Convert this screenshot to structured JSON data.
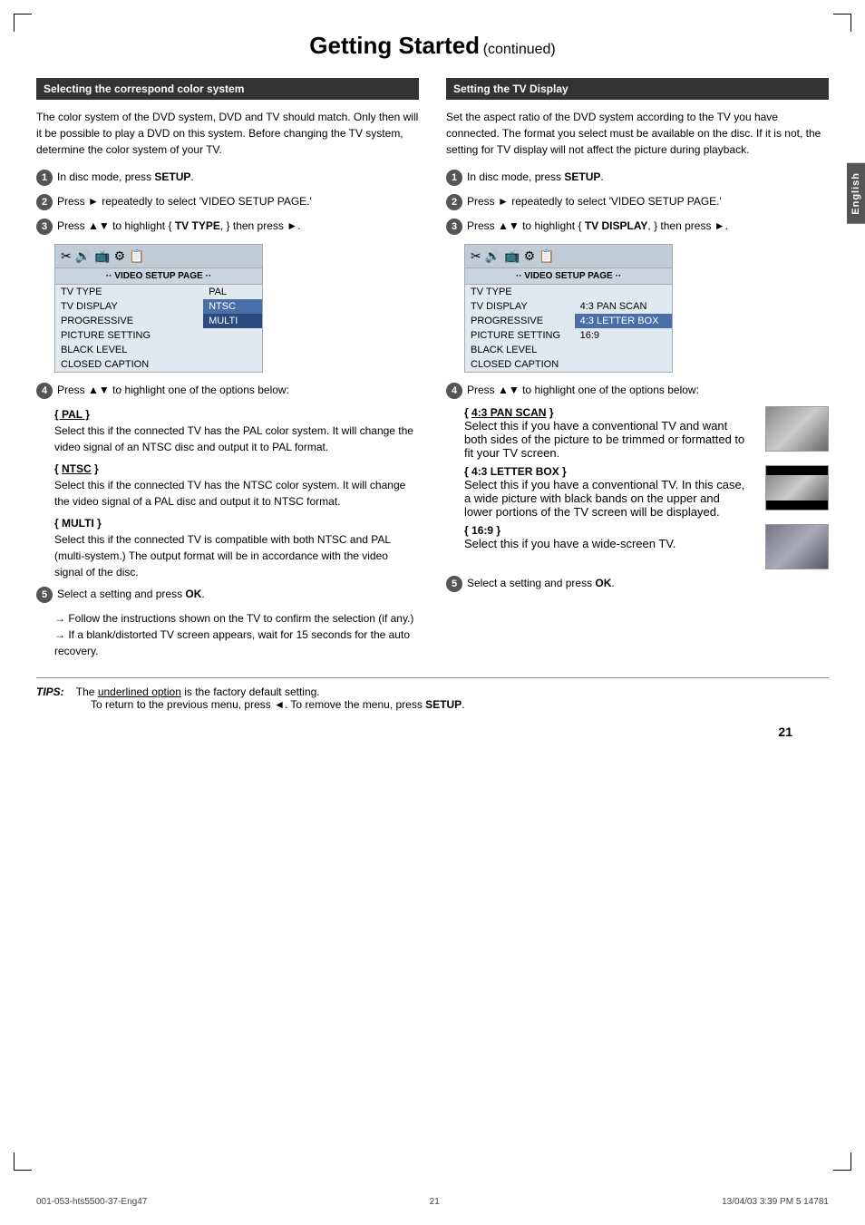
{
  "page": {
    "title": "Getting Started",
    "title_suffix": "(continued)",
    "page_number": "21",
    "english_tab": "English"
  },
  "footer": {
    "left": "001-053-hts5500-37-Eng47",
    "center": "21",
    "right": "13/04/03  3:39 PM  5  14781"
  },
  "tips": {
    "label": "TIPS:",
    "line1": "The underlined option is the factory default setting.",
    "line2": "To return to the previous menu, press ◄. To remove the menu, press SETUP."
  },
  "left_section": {
    "header": "Selecting the correspond color system",
    "intro": "The color system of the DVD system, DVD and TV should match. Only then will it be possible to play a DVD on this system.  Before changing the TV system, determine the color system of your TV.",
    "step1": "In disc mode, press SETUP.",
    "step2": "Press ► repeatedly to select 'VIDEO SETUP PAGE.'",
    "step3": "Press ▲▼ to highlight { TV TYPE, } then press ►.",
    "screen": {
      "page_label": "·· VIDEO SETUP PAGE ··",
      "rows": [
        {
          "label": "TV TYPE",
          "value": "PAL"
        },
        {
          "label": "TV DISPLAY",
          "value": ""
        },
        {
          "label": "PROGRESSIVE",
          "value": "NTSC"
        },
        {
          "label": "PICTURE SETTING",
          "value": "MULTI"
        },
        {
          "label": "BLACK LEVEL",
          "value": ""
        },
        {
          "label": "CLOSED CAPTION",
          "value": ""
        }
      ]
    },
    "step4": "Press ▲▼ to highlight one of the options below:",
    "options": [
      {
        "title": "PAL",
        "underline": true,
        "text": "Select this if the connected TV has the PAL color system. It will change the video signal of an NTSC disc and output it to PAL format."
      },
      {
        "title": "NTSC",
        "underline": true,
        "text": "Select this if the connected TV has the NTSC color system. It will change the video signal of a PAL disc and output it to NTSC format."
      },
      {
        "title": "MULTI",
        "underline": false,
        "text": "Select this if the connected TV is compatible with both NTSC and PAL (multi-system.) The output format will be in accordance with the video signal of the disc."
      }
    ],
    "step5_text": "Select a setting and press OK.",
    "step5_note1": "→ Follow the instructions shown on the TV to confirm the selection (if any.)",
    "step5_note2": "→ If a blank/distorted TV screen appears, wait for 15 seconds for the auto recovery."
  },
  "right_section": {
    "header": "Setting the TV Display",
    "intro": "Set the aspect ratio of the DVD system according to the TV you have connected. The format you select must be available on the disc.  If it is not, the setting for TV display will not affect the picture during playback.",
    "step1": "In disc mode, press SETUP.",
    "step2": "Press ► repeatedly to select 'VIDEO SETUP PAGE.'",
    "step3": "Press ▲▼ to highlight { TV DISPLAY, } then press ►.",
    "screen": {
      "page_label": "·· VIDEO SETUP PAGE ··",
      "rows": [
        {
          "label": "TV TYPE",
          "value": ""
        },
        {
          "label": "TV DISPLAY",
          "value": "4:3 PAN SCAN"
        },
        {
          "label": "PROGRESSIVE",
          "value": "4:3 LETTER BOX",
          "highlight": true
        },
        {
          "label": "PICTURE SETTING",
          "value": "16:9"
        },
        {
          "label": "BLACK LEVEL",
          "value": ""
        },
        {
          "label": "CLOSED CAPTION",
          "value": ""
        }
      ]
    },
    "step4": "Press ▲▼ to highlight one of the options below:",
    "options": [
      {
        "title": "4:3 PAN SCAN",
        "underline": true,
        "text": "Select this if you have a conventional TV and want both sides of the picture to be trimmed or formatted to fit your TV screen.",
        "has_image": true,
        "image_type": "landscape"
      },
      {
        "title": "4:3 LETTER BOX",
        "underline": false,
        "text": "Select this if you have a conventional TV.  In this case, a wide picture with black bands on the upper and lower portions of the TV screen will be displayed.",
        "has_image": true,
        "image_type": "letterbox"
      },
      {
        "title": "16:9",
        "underline": false,
        "text": "Select this if you have a wide-screen TV.",
        "has_image": true,
        "image_type": "wide"
      }
    ],
    "step5_text": "Select a setting and press OK."
  }
}
